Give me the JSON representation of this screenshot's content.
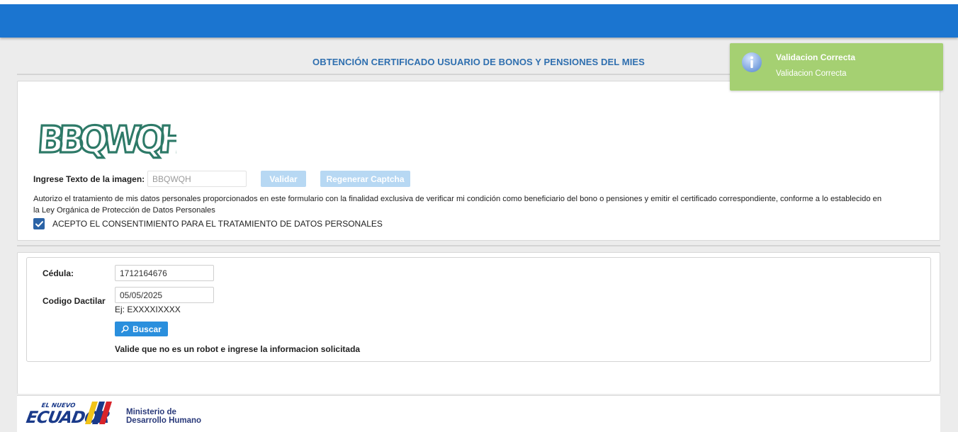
{
  "header": {
    "title": "OBTENCIÓN CERTIFICADO USUARIO DE BONOS Y PENSIONES DEL MIES"
  },
  "captcha": {
    "image_text": "BBQWQH",
    "label": "Ingrese Texto de la imagen:",
    "input_value": "BBQWQH",
    "validate_label": "Validar",
    "regenerate_label": "Regenerar Captcha"
  },
  "consent": {
    "text_line1": "Autorizo el tratamiento de mis datos personales proporcionados en este formulario con la finalidad exclusiva de verificar mi condición como beneficiario del bono o pensiones y emitir el certificado correspondiente, conforme a lo establecido en",
    "text_line2": "la Ley Orgánica de Protección de Datos Personales",
    "checkbox_label": "ACEPTO EL CONSENTIMIENTO PARA EL TRATAMIENTO DE DATOS PERSONALES",
    "checked": true
  },
  "form": {
    "cedula_label": "Cédula:",
    "cedula_value": "1712164676",
    "codigo_label": "Codigo Dactilar",
    "codigo_value": "05/05/2025",
    "codigo_example": "Ej: EXXXXIXXXX",
    "search_label": "Buscar",
    "validate_message": "Valide que no es un robot e ingrese la informacion solicitada"
  },
  "footer": {
    "logo_small_text": "EL NUEVO",
    "logo_main_text": "ECUADOR",
    "ministry_line1": "Ministerio de",
    "ministry_line2": "Desarrollo Humano"
  },
  "toast": {
    "title": "Validacion Correcta",
    "message": "Validacion Correcta"
  },
  "colors": {
    "topbar": "#1b75d0",
    "title": "#2f6faf",
    "toast": "#a5d072",
    "primary_button": "#2a8fdd",
    "disabled_button": "#b7d8f3",
    "checkbox": "#2b63a6",
    "captcha_ink": "#2e7a68"
  },
  "icons": {
    "toast": "info-icon",
    "search": "search-icon",
    "checkbox": "check-icon"
  }
}
